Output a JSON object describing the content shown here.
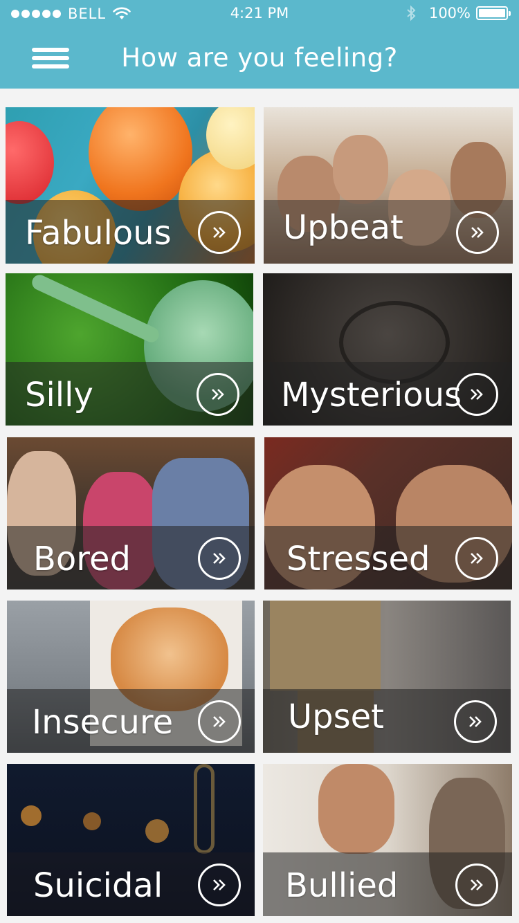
{
  "status_bar": {
    "carrier": "BELL",
    "time": "4:21 PM",
    "battery": "100%"
  },
  "nav": {
    "title": "How are you feeling?"
  },
  "moods": [
    {
      "label": "Fabulous"
    },
    {
      "label": "Upbeat"
    },
    {
      "label": "Silly"
    },
    {
      "label": "Mysterious"
    },
    {
      "label": "Bored"
    },
    {
      "label": "Stressed"
    },
    {
      "label": "Insecure"
    },
    {
      "label": "Upset"
    },
    {
      "label": "Suicidal"
    },
    {
      "label": "Bullied"
    }
  ],
  "colors": {
    "header": "#5bb8cc",
    "background": "#f3f3f3",
    "overlay": "#232323"
  }
}
